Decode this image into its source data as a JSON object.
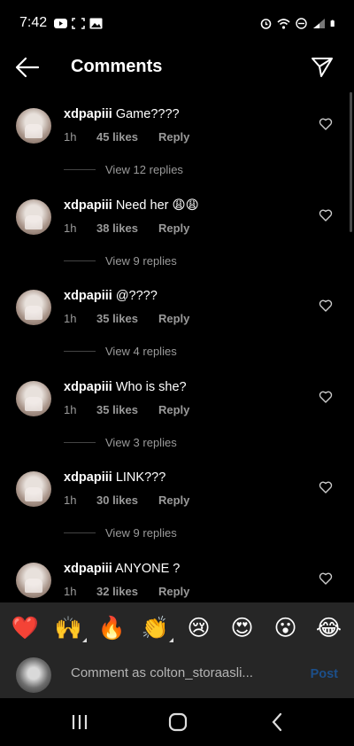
{
  "status_bar": {
    "time": "7:42"
  },
  "header": {
    "title": "Comments"
  },
  "comments": [
    {
      "user": "xdpapiii",
      "text": "Game????",
      "time": "1h",
      "likes": "45 likes",
      "reply": "Reply",
      "replies": "View 12 replies"
    },
    {
      "user": "xdpapiii",
      "text": "Need her 😩😩",
      "time": "1h",
      "likes": "38 likes",
      "reply": "Reply",
      "replies": "View 9 replies"
    },
    {
      "user": "xdpapiii",
      "text": "@????",
      "time": "1h",
      "likes": "35 likes",
      "reply": "Reply",
      "replies": "View 4 replies"
    },
    {
      "user": "xdpapiii",
      "text": "Who is she?",
      "time": "1h",
      "likes": "35 likes",
      "reply": "Reply",
      "replies": "View 3 replies"
    },
    {
      "user": "xdpapiii",
      "text": "LINK???",
      "time": "1h",
      "likes": "30 likes",
      "reply": "Reply",
      "replies": "View 9 replies"
    },
    {
      "user": "xdpapiii",
      "text": "ANYONE ?",
      "time": "1h",
      "likes": "32 likes",
      "reply": "Reply",
      "replies": ""
    }
  ],
  "emoji_bar": [
    "❤️",
    "🙌",
    "🔥",
    "👏",
    "😢",
    "😍",
    "😮",
    "😂"
  ],
  "compose": {
    "placeholder": "Comment as colton_storaasli...",
    "post_label": "Post"
  },
  "colors": {
    "background": "#000000",
    "panel": "#262626",
    "muted": "#9a9a9a",
    "post_disabled": "#1c4f8a"
  }
}
